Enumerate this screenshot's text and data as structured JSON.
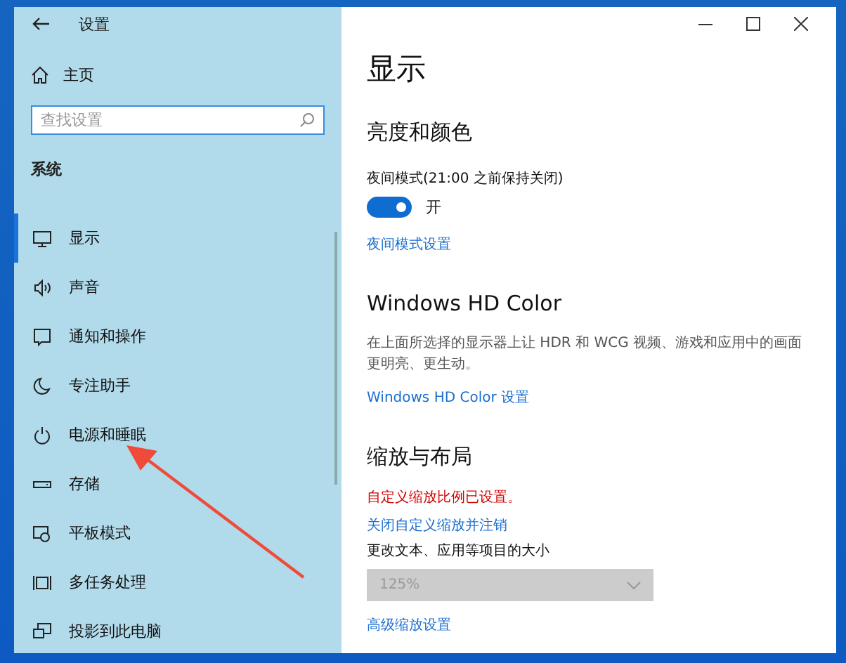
{
  "window": {
    "title": "设置"
  },
  "sidebar": {
    "home": "主页",
    "search": {
      "placeholder": "查找设置"
    },
    "section": "系统",
    "items": [
      {
        "label": "显示",
        "selected": true
      },
      {
        "label": "声音",
        "selected": false
      },
      {
        "label": "通知和操作",
        "selected": false
      },
      {
        "label": "专注助手",
        "selected": false
      },
      {
        "label": "电源和睡眠",
        "selected": false
      },
      {
        "label": "存储",
        "selected": false
      },
      {
        "label": "平板模式",
        "selected": false
      },
      {
        "label": "多任务处理",
        "selected": false
      },
      {
        "label": "投影到此电脑",
        "selected": false
      }
    ]
  },
  "main": {
    "title": "显示",
    "sections": [
      {
        "heading": "亮度和颜色",
        "items": [
          {
            "kind": "label",
            "text": "夜间模式(21:00 之前保持关闭)"
          },
          {
            "kind": "toggle",
            "on": true,
            "text": "开"
          },
          {
            "kind": "link",
            "text": "夜间模式设置"
          }
        ]
      },
      {
        "heading": "Windows HD Color",
        "items": [
          {
            "kind": "description",
            "text": "在上面所选择的显示器上让 HDR 和 WCG 视频、游戏和应用中的画面更明亮、更生动。"
          },
          {
            "kind": "link",
            "text": "Windows HD Color 设置"
          }
        ]
      },
      {
        "heading": "缩放与布局",
        "items": [
          {
            "kind": "warning",
            "text": "自定义缩放比例已设置。"
          },
          {
            "kind": "link",
            "text": "关闭自定义缩放并注销"
          },
          {
            "kind": "label",
            "text": "更改文本、应用等项目的大小"
          },
          {
            "kind": "dropdown",
            "value": "125%",
            "disabled": true
          },
          {
            "kind": "link",
            "text": "高级缩放设置"
          }
        ]
      }
    ]
  }
}
